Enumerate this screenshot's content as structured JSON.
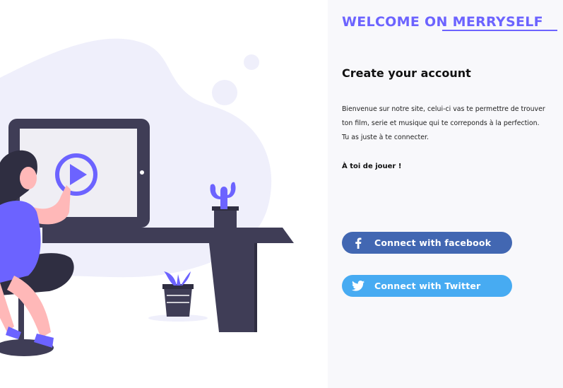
{
  "brand": {
    "title": "WELCOME ON MERRYSELF",
    "accent_color": "#6c63ff"
  },
  "form": {
    "heading": "Create your account",
    "intro_lines": [
      "Bienvenue sur notre site, celui-ci vas te permettre de trouver",
      "ton film, serie et musique qui te correponds à la perfection.",
      "Tu as juste à te connecter."
    ],
    "cta": "À toi de jouer !"
  },
  "social": {
    "facebook": {
      "label": "Connect with facebook",
      "icon": "facebook-icon",
      "color": "#4267b2"
    },
    "twitter": {
      "label": "Connect with Twitter",
      "icon": "twitter-icon",
      "color": "#47abf2"
    }
  },
  "illustration": {
    "description_icon": "woman-at-desk-watching-video-illustration",
    "play_icon": "play-icon"
  }
}
